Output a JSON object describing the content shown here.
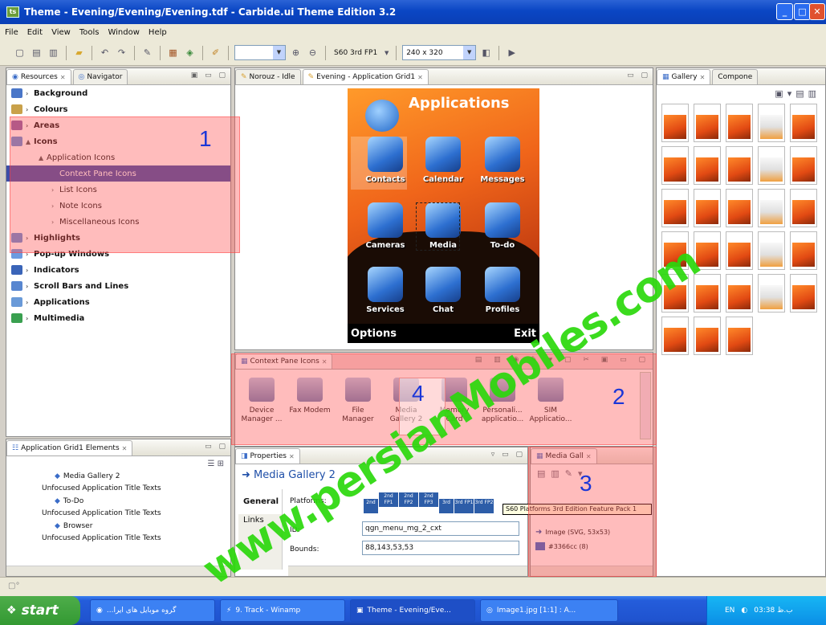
{
  "window": {
    "title": "Theme - Evening/Evening/Evening.tdf - Carbide.ui Theme Edition 3.2",
    "app_icon": "ts"
  },
  "menu": [
    "File",
    "Edit",
    "View",
    "Tools",
    "Window",
    "Help"
  ],
  "toolbar": {
    "platform_label": "S60 3rd FP1",
    "resolution": "240 x 320"
  },
  "resources": {
    "tabs": [
      "Resources",
      "Navigator"
    ],
    "items": [
      {
        "label": "Background",
        "bold": true,
        "indent": 0,
        "color": "#4a76c8"
      },
      {
        "label": "Colours",
        "bold": true,
        "indent": 0,
        "color": "#c9a14a"
      },
      {
        "label": "Areas",
        "bold": true,
        "indent": 0,
        "color": "#8a5fa8"
      },
      {
        "label": "Icons",
        "bold": true,
        "indent": 0,
        "color": "#5f8fd8",
        "open": true
      },
      {
        "label": "Application Icons",
        "bold": false,
        "indent": 1,
        "open": true
      },
      {
        "label": "Context Pane Icons",
        "bold": false,
        "indent": 2,
        "selected": true
      },
      {
        "label": "List Icons",
        "bold": false,
        "indent": 2
      },
      {
        "label": "Note Icons",
        "bold": false,
        "indent": 2
      },
      {
        "label": "Miscellaneous Icons",
        "bold": false,
        "indent": 2
      },
      {
        "label": "Highlights",
        "bold": true,
        "indent": 0,
        "color": "#5f8fd8"
      },
      {
        "label": "Pop-up Windows",
        "bold": true,
        "indent": 0,
        "color": "#6c9be0"
      },
      {
        "label": "Indicators",
        "bold": true,
        "indent": 0,
        "color": "#3a64b8"
      },
      {
        "label": "Scroll Bars and Lines",
        "bold": true,
        "indent": 0,
        "color": "#5886d0"
      },
      {
        "label": "Applications",
        "bold": true,
        "indent": 0,
        "color": "#6a9ad8"
      },
      {
        "label": "Multimedia",
        "bold": true,
        "indent": 0,
        "color": "#3aa050"
      }
    ]
  },
  "editor": {
    "tabs": [
      "Norouz - Idle",
      "Evening - Application Grid1"
    ],
    "phone": {
      "title": "Applications",
      "apps": [
        "Contacts",
        "Calendar",
        "Messages",
        "Cameras",
        "Media",
        "To-do",
        "Services",
        "Chat",
        "Profiles"
      ],
      "softkey_left": "Options",
      "softkey_right": "Exit"
    }
  },
  "context_pane": {
    "title": "Context Pane Icons",
    "items": [
      "Device Manager ...",
      "Fax Modem",
      "File Manager",
      "Media Gallery 2",
      "Memory Card",
      "Personali... applicatio...",
      "SIM Applicatio..."
    ]
  },
  "elements": {
    "title": "Application Grid1 Elements",
    "items": [
      {
        "label": "Media Gallery 2",
        "indent": 1
      },
      {
        "label": "Unfocused Application Title Texts",
        "indent": 2
      },
      {
        "label": "To-Do",
        "indent": 1
      },
      {
        "label": "Unfocused Application Title Texts",
        "indent": 2
      },
      {
        "label": "Browser",
        "indent": 1
      },
      {
        "label": "Unfocused Application Title Texts",
        "indent": 2
      }
    ]
  },
  "properties": {
    "title": "Properties",
    "selected": "Media Gallery 2",
    "tabs": [
      "General",
      "Links"
    ],
    "platforms_label": "Platforms:",
    "platform_badges": [
      "2nd",
      "2nd FP1",
      "2nd FP2",
      "2nd FP3",
      "3rd",
      "3rd FP1",
      "3rd FP2"
    ],
    "id_label": "ID:",
    "id_value": "qgn_menu_mg_2_cxt",
    "bounds_label": "Bounds:",
    "bounds_value": "88,143,53,53",
    "tooltip": "S60 Platforms 3rd Edition Feature Pack 1"
  },
  "media": {
    "title": "Media Gall",
    "items": [
      "Image (SVG, 53x53)",
      "#3366cc (8)"
    ]
  },
  "gallery": {
    "tabs": [
      "Gallery",
      "Compone"
    ]
  },
  "taskbar": {
    "start": "start",
    "tasks": [
      "...گروه موبایل های ایرا",
      "9. Track - Winamp",
      "Theme - Evening/Eve...",
      "Image1.jpg [1:1] : A..."
    ],
    "lang": "EN",
    "clock": "03:38 ب.ظ"
  },
  "overlay": {
    "numbers": [
      "1",
      "2",
      "3",
      "4"
    ],
    "watermark": "www.persianMobiles.com"
  },
  "colors": {
    "selection": "#3d4ca8",
    "highlight": "#ff5050",
    "watermark": "#2bd80c",
    "taskbar": "#245ddb"
  }
}
